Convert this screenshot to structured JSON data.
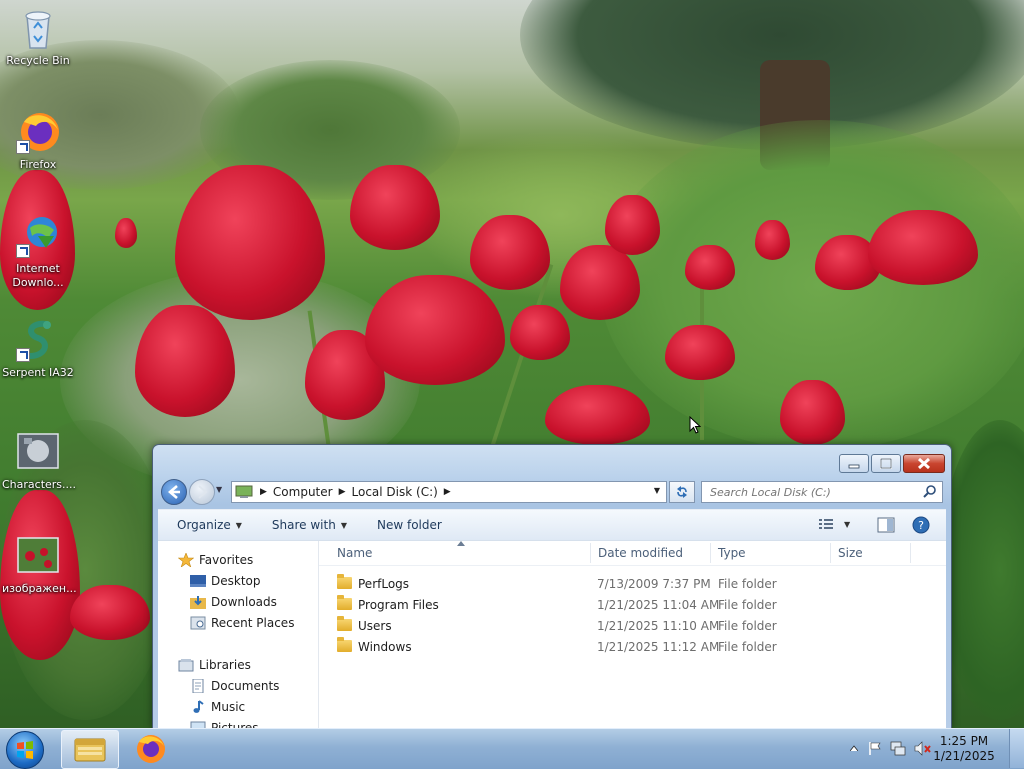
{
  "desktop": {
    "icons": [
      {
        "label": "Recycle Bin",
        "icon": "recycle-bin-icon"
      },
      {
        "label": "Firefox",
        "icon": "firefox-icon"
      },
      {
        "label": "Internet Downlo...",
        "icon": "internet-download-manager-icon"
      },
      {
        "label": "Serpent IA32",
        "icon": "serpent-icon"
      },
      {
        "label": "Characters....",
        "icon": "characters-icon"
      },
      {
        "label": "изображен...",
        "icon": "image-file-icon"
      }
    ]
  },
  "explorer": {
    "breadcrumb": [
      "Computer",
      "Local Disk (C:)"
    ],
    "search_placeholder": "Search Local Disk (C:)",
    "toolbar": {
      "organize": "Organize",
      "share_with": "Share with",
      "new_folder": "New folder"
    },
    "nav": {
      "favorites": "Favorites",
      "favorites_items": [
        "Desktop",
        "Downloads",
        "Recent Places"
      ],
      "libraries": "Libraries",
      "libraries_items": [
        "Documents",
        "Music",
        "Pictures"
      ]
    },
    "columns": [
      "Name",
      "Date modified",
      "Type",
      "Size"
    ],
    "files": [
      {
        "name": "PerfLogs",
        "date": "7/13/2009 7:37 PM",
        "type": "File folder"
      },
      {
        "name": "Program Files",
        "date": "1/21/2025 11:04 AM",
        "type": "File folder"
      },
      {
        "name": "Users",
        "date": "1/21/2025 11:10 AM",
        "type": "File folder"
      },
      {
        "name": "Windows",
        "date": "1/21/2025 11:12 AM",
        "type": "File folder"
      }
    ]
  },
  "taskbar": {
    "time": "1:25 PM",
    "date": "1/21/2025"
  },
  "colors": {
    "window_frame": "#a9c4e3",
    "taskbar": "#8fb0d4",
    "link_text": "#1e395b",
    "column_header": "#4c607a"
  }
}
